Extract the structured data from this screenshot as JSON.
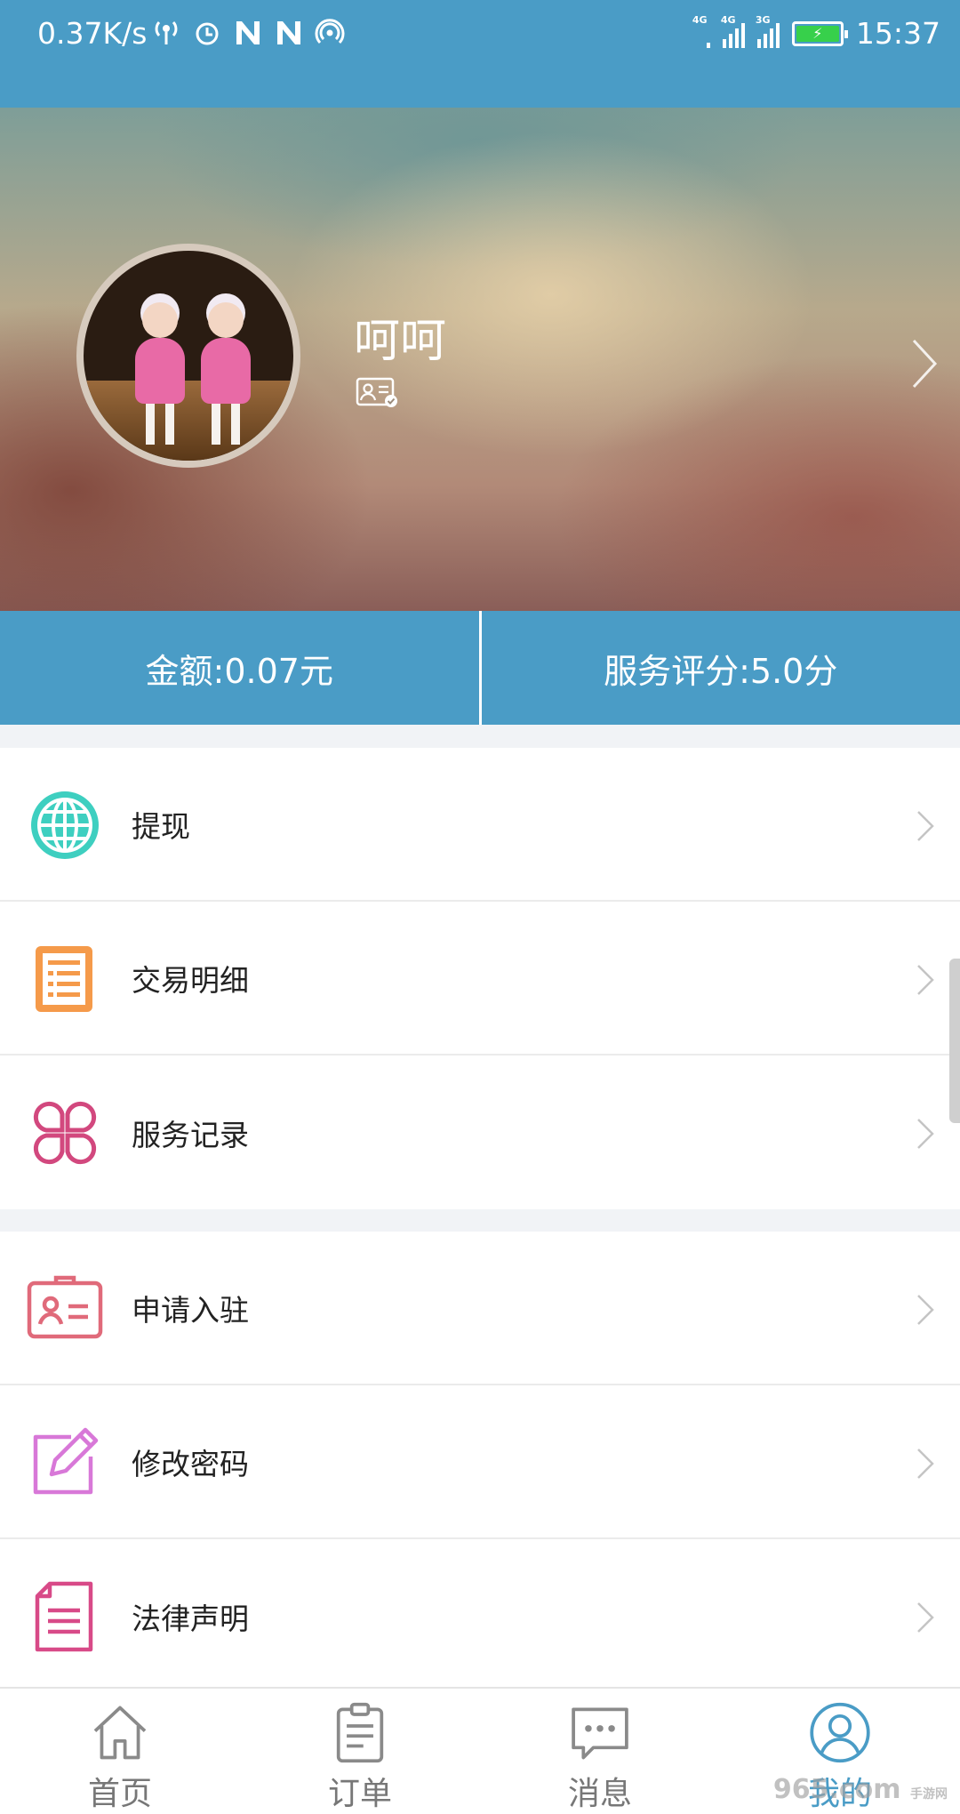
{
  "status_bar": {
    "network_speed": "0.37K/s",
    "signal_1": "4G",
    "signal_2": "4G",
    "signal_3": "3G",
    "battery": "charging",
    "time": "15:37"
  },
  "profile": {
    "name": "呵呵",
    "badge_icon": "id-card-verified-icon"
  },
  "stats": {
    "balance": "金额:0.07元",
    "rating": "服务评分:5.0分"
  },
  "menu_group_1": [
    {
      "label": "提现",
      "icon": "globe-icon",
      "color": "#3ecfc0"
    },
    {
      "label": "交易明细",
      "icon": "document-list-icon",
      "color": "#f59a4a"
    },
    {
      "label": "服务记录",
      "icon": "clover-grid-icon",
      "color": "#d2487e"
    }
  ],
  "menu_group_2": [
    {
      "label": "申请入驻",
      "icon": "id-card-icon",
      "color": "#e06a7a"
    },
    {
      "label": "修改密码",
      "icon": "edit-pencil-icon",
      "color": "#d878d8"
    },
    {
      "label": "法律声明",
      "icon": "legal-document-icon",
      "color": "#d84a88"
    }
  ],
  "tabbar": [
    {
      "label": "首页",
      "icon": "home-icon",
      "active": false
    },
    {
      "label": "订单",
      "icon": "order-clipboard-icon",
      "active": false
    },
    {
      "label": "消息",
      "icon": "message-bubble-icon",
      "active": false
    },
    {
      "label": "我的",
      "icon": "user-profile-icon",
      "active": true
    }
  ],
  "watermark": "965.com",
  "watermark_sub": "手游网",
  "colors": {
    "primary": "#4a9cc6",
    "background": "#f1f3f6"
  }
}
